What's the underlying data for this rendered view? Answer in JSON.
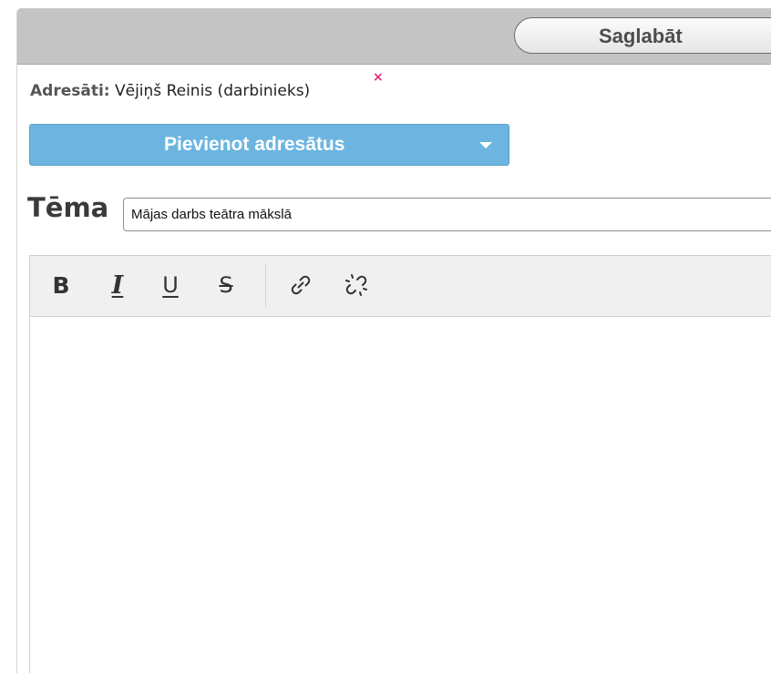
{
  "toolbar": {
    "save_label": "Saglabāt"
  },
  "recipients": {
    "label": "Adresāti:",
    "value": "Vējiņš Reinis (darbinieks)",
    "remove_glyph": "×"
  },
  "add_recipients": {
    "label": "Pievienot adresātus",
    "icon": "chevron-down-icon"
  },
  "subject": {
    "label": "Tēma",
    "value": "Mājas darbs teātra mākslā"
  },
  "editor": {
    "tools": {
      "bold": "B",
      "italic": "I",
      "underline": "U",
      "strike": "S",
      "link_icon": "link-icon",
      "unlink_icon": "unlink-icon"
    },
    "body_text": ""
  },
  "colors": {
    "accent_button": "#6cb5e0",
    "remove_x": "#e0287c",
    "topbar": "#c4c4c4"
  }
}
